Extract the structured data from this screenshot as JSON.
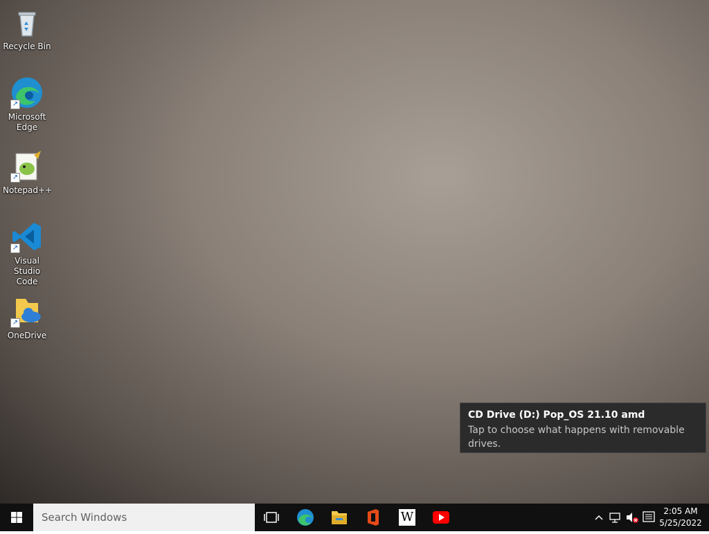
{
  "desktop": {
    "icons": [
      {
        "label": "Recycle Bin",
        "icon": "recycle-bin-icon"
      },
      {
        "label": "Microsoft Edge",
        "icon": "edge-icon"
      },
      {
        "label": "Notepad++",
        "icon": "notepad-plus-plus-icon"
      },
      {
        "label": "Visual Studio Code",
        "icon": "vscode-icon"
      },
      {
        "label": "OneDrive",
        "icon": "onedrive-icon"
      }
    ]
  },
  "toast": {
    "title": "CD Drive (D:) Pop_OS 21.10 amd",
    "message": "Tap to choose what happens with removable drives."
  },
  "taskbar": {
    "search_placeholder": "Search Windows",
    "pinned": [
      "task-view-icon",
      "edge-icon",
      "file-explorer-icon",
      "office-icon",
      "wikipedia-icon",
      "youtube-icon"
    ],
    "wiki_letter": "W",
    "clock": {
      "time": "2:05 AM",
      "date": "5/25/2022"
    }
  },
  "colors": {
    "taskbar": "#101010",
    "toast_bg": "#2b2b2b",
    "accent": "#0078d4"
  }
}
